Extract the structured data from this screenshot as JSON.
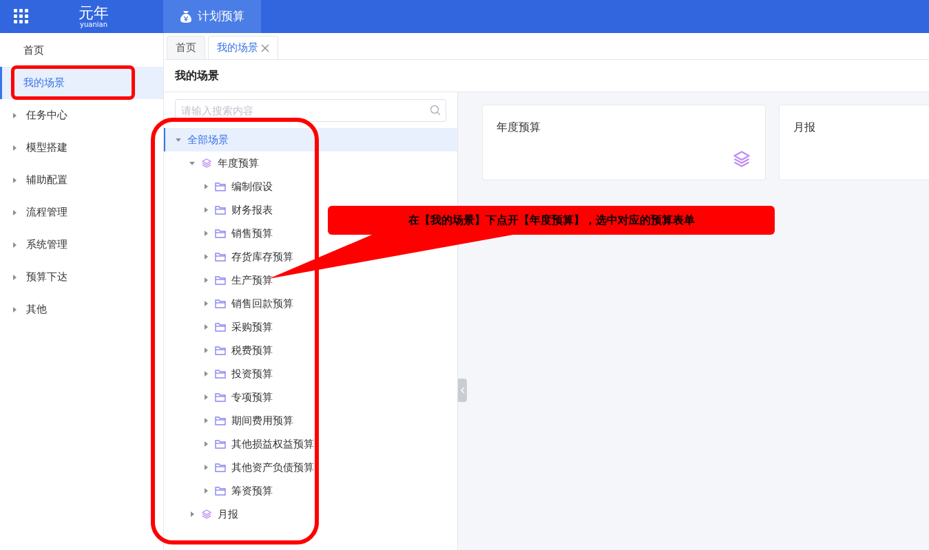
{
  "header": {
    "logo": "元年",
    "logo_sub": "yuanian",
    "app_tab": "计划预算"
  },
  "sidebar": {
    "items": [
      {
        "label": "首页",
        "kind": "link",
        "selected": false
      },
      {
        "label": "我的场景",
        "kind": "link",
        "selected": true
      },
      {
        "label": "任务中心",
        "kind": "group",
        "selected": false
      },
      {
        "label": "模型搭建",
        "kind": "group",
        "selected": false
      },
      {
        "label": "辅助配置",
        "kind": "group",
        "selected": false
      },
      {
        "label": "流程管理",
        "kind": "group",
        "selected": false
      },
      {
        "label": "系统管理",
        "kind": "group",
        "selected": false
      },
      {
        "label": "预算下达",
        "kind": "group",
        "selected": false
      },
      {
        "label": "其他",
        "kind": "group",
        "selected": false
      }
    ]
  },
  "tabs": [
    {
      "label": "首页",
      "selected": false,
      "closable": false
    },
    {
      "label": "我的场景",
      "selected": true,
      "closable": true
    }
  ],
  "page_title": "我的场景",
  "search": {
    "placeholder": "请输入搜索内容"
  },
  "tree": [
    {
      "label": "全部场景",
      "kind": "root",
      "expanded": true,
      "selected": true,
      "children": [
        {
          "label": "年度预算",
          "kind": "scene",
          "expanded": true,
          "selected": false,
          "children": [
            {
              "label": "编制假设",
              "kind": "folder",
              "expanded": false,
              "selected": false
            },
            {
              "label": "财务报表",
              "kind": "folder",
              "expanded": false,
              "selected": false
            },
            {
              "label": "销售预算",
              "kind": "folder",
              "expanded": false,
              "selected": false
            },
            {
              "label": "存货库存预算",
              "kind": "folder",
              "expanded": false,
              "selected": false
            },
            {
              "label": "生产预算",
              "kind": "folder",
              "expanded": false,
              "selected": false
            },
            {
              "label": "销售回款预算",
              "kind": "folder",
              "expanded": false,
              "selected": false
            },
            {
              "label": "采购预算",
              "kind": "folder",
              "expanded": false,
              "selected": false
            },
            {
              "label": "税费预算",
              "kind": "folder",
              "expanded": false,
              "selected": false
            },
            {
              "label": "投资预算",
              "kind": "folder",
              "expanded": false,
              "selected": false
            },
            {
              "label": "专项预算",
              "kind": "folder",
              "expanded": false,
              "selected": false
            },
            {
              "label": "期间费用预算",
              "kind": "folder",
              "expanded": false,
              "selected": false
            },
            {
              "label": "其他损益权益预算",
              "kind": "folder",
              "expanded": false,
              "selected": false
            },
            {
              "label": "其他资产负债预算",
              "kind": "folder",
              "expanded": false,
              "selected": false
            },
            {
              "label": "筹资预算",
              "kind": "folder",
              "expanded": false,
              "selected": false
            }
          ]
        },
        {
          "label": "月报",
          "kind": "scene",
          "expanded": false,
          "selected": false
        }
      ]
    }
  ],
  "cards": [
    {
      "title": "年度预算",
      "icon": true
    },
    {
      "title": "月报"
    }
  ],
  "annotation": {
    "text": "在【我的场景】下点开【年度预算】，选中对应的预算表单"
  }
}
